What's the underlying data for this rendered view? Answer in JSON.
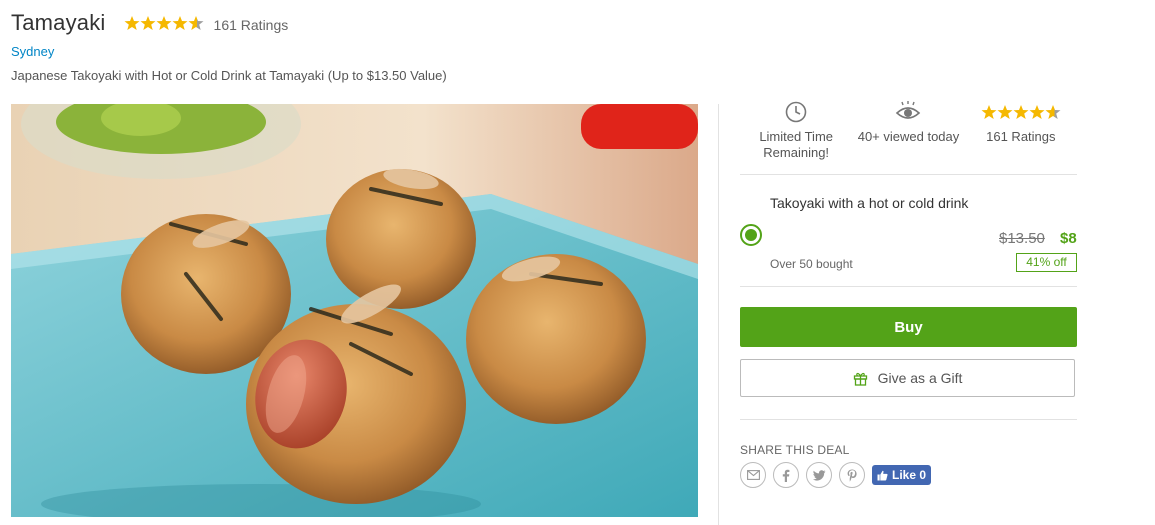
{
  "deal": {
    "title": "Tamayaki",
    "rating_value": 4.5,
    "rating_max": 5,
    "ratings_count": "161 Ratings",
    "city": "Sydney",
    "subtitle": "Japanese Takoyaki with Hot or Cold Drink at Tamayaki (Up to $13.50 Value)"
  },
  "highlights": {
    "time": "Limited Time Remaining!",
    "viewed": "40+ viewed today",
    "ratings": "161 Ratings"
  },
  "option": {
    "title": "Takoyaki with a hot or cold drink",
    "original_price": "$13.50",
    "sale_price": "$8",
    "bought": "Over 50 bought",
    "discount": "41% off",
    "selected": true
  },
  "actions": {
    "buy_label": "Buy",
    "gift_label": "Give as a Gift"
  },
  "share": {
    "label": "SHARE THIS DEAL",
    "fb_like_label": "Like 0"
  },
  "colors": {
    "accent_green": "#53a318",
    "link_blue": "#0185c6",
    "star_gold": "#f5b800",
    "facebook_blue": "#4267b2"
  }
}
